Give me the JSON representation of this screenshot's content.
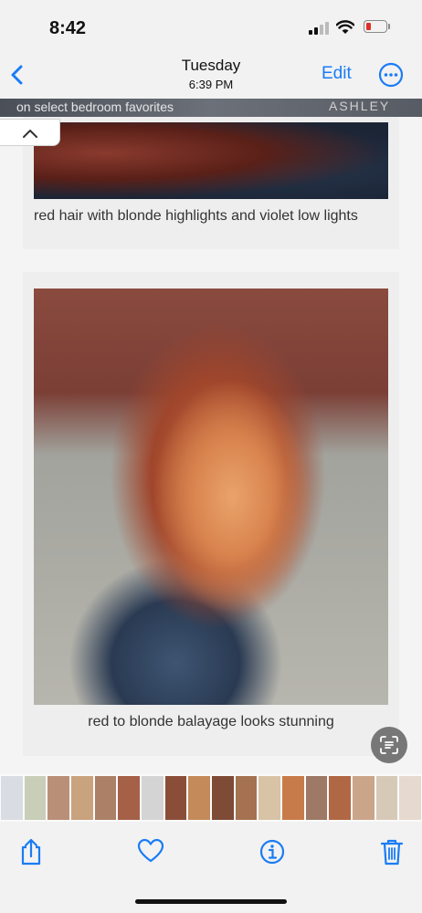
{
  "status_bar": {
    "time": "8:42"
  },
  "nav": {
    "title": "Tuesday",
    "subtitle": "6:39 PM",
    "edit_label": "Edit"
  },
  "ad": {
    "text": "on select bedroom favorites",
    "brand": "ASHLEY"
  },
  "cards": [
    {
      "caption": "red hair with blonde highlights and violet low lights"
    },
    {
      "caption": "red to blonde balayage looks stunning"
    }
  ],
  "thumbnails": [
    "#d9dde3",
    "#c8ceb8",
    "#b98f78",
    "#c9a37e",
    "#ab8067",
    "#a56048",
    "#d4d4d4",
    "#8a4e38",
    "#c48a5a",
    "#7d4b36",
    "#a47250",
    "#d8c3a6",
    "#c87b4a",
    "#9d7966",
    "#b06844",
    "#caa58a",
    "#d7c9b8",
    "#e6d9d0"
  ],
  "colors": {
    "accent": "#1a7cf5",
    "battery_low": "#e0302b"
  },
  "icons": [
    "back-chevron-icon",
    "more-icon",
    "collapse-chevron-icon",
    "live-text-icon",
    "share-icon",
    "heart-icon",
    "info-icon",
    "trash-icon"
  ]
}
